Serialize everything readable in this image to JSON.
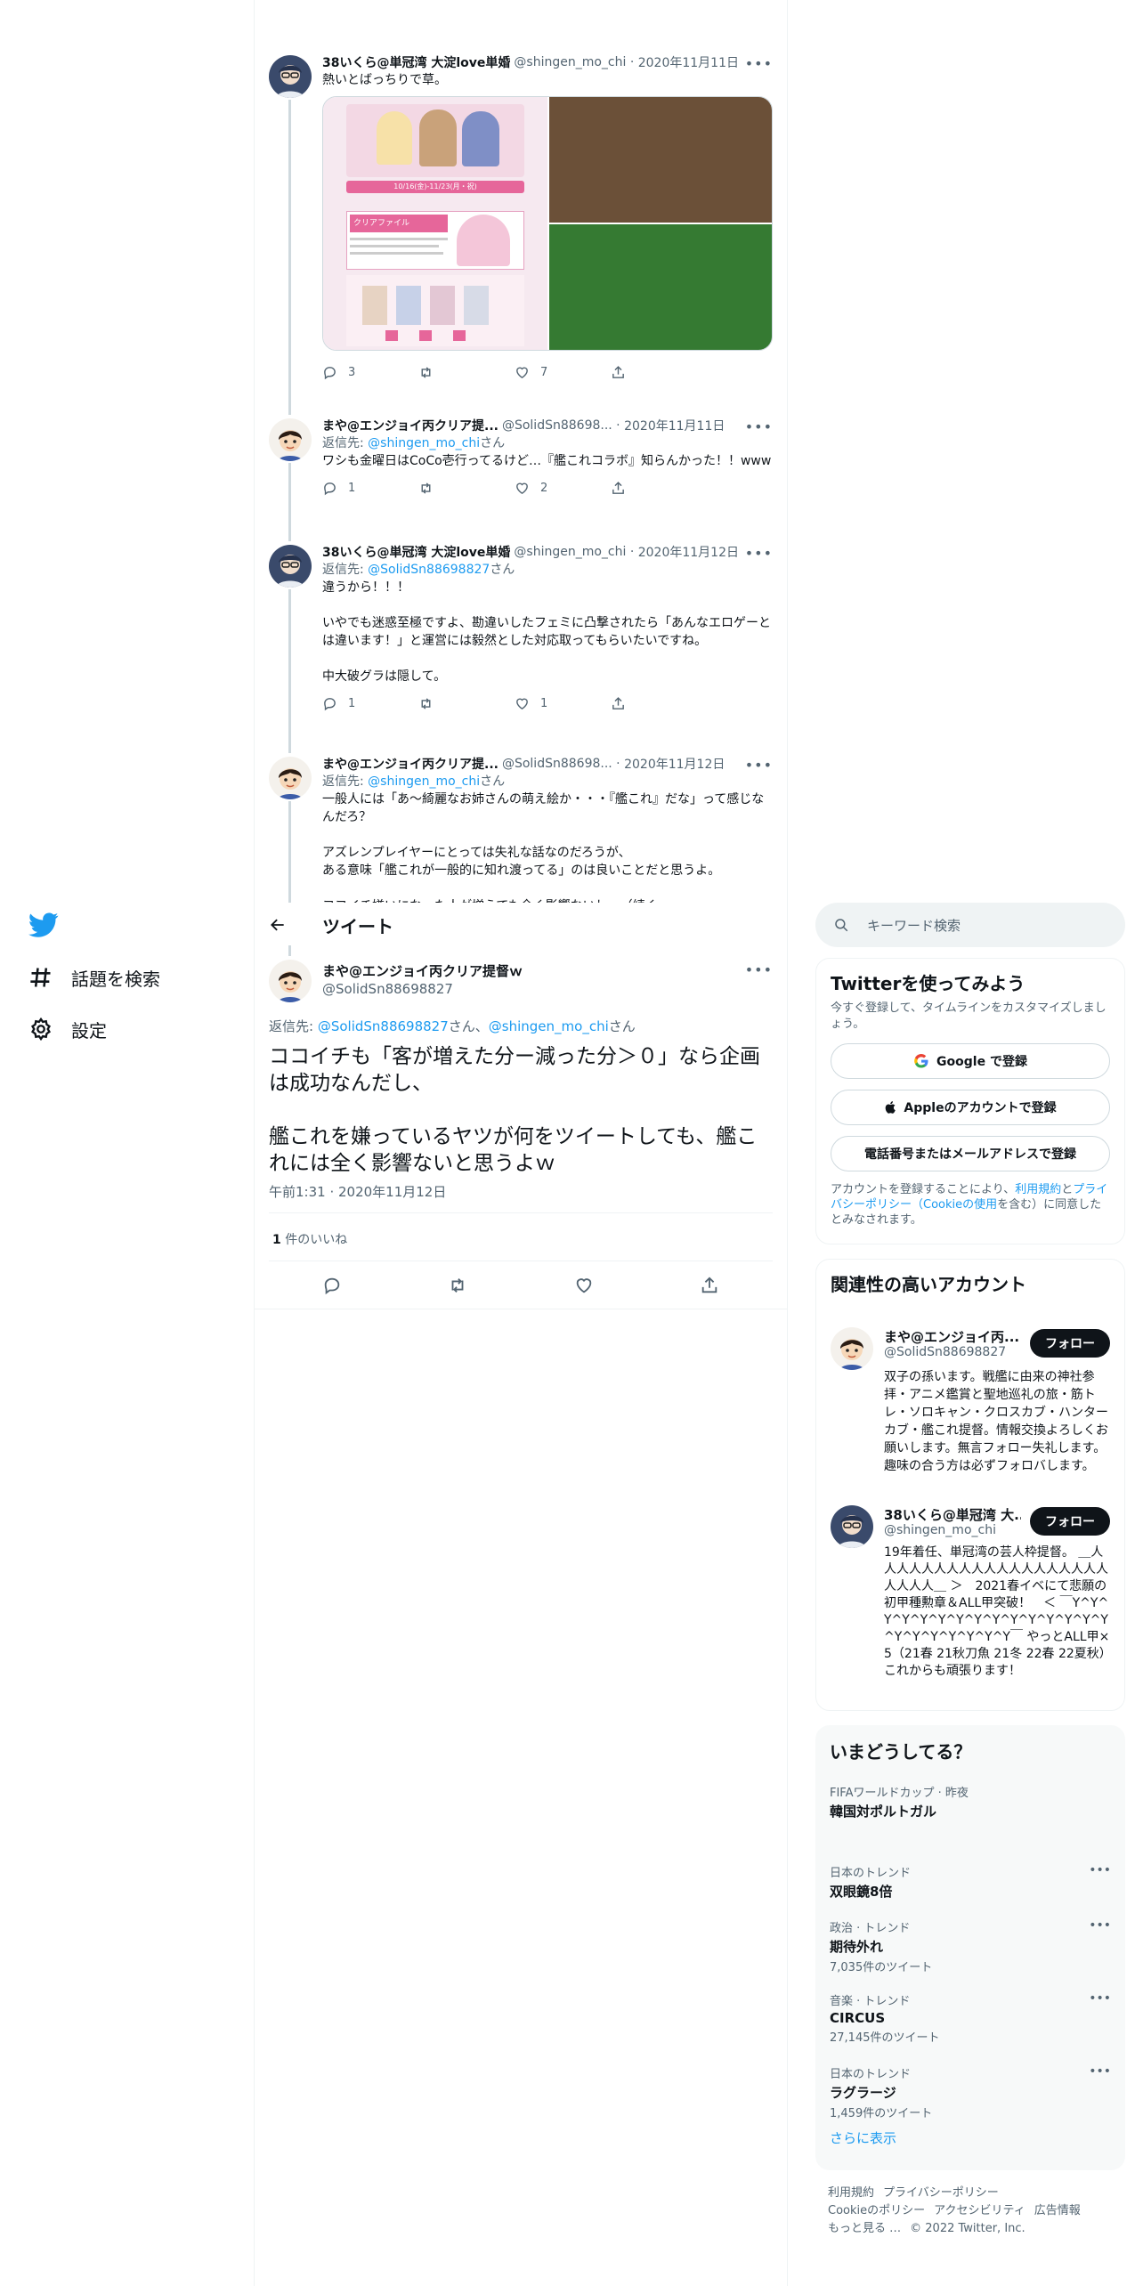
{
  "nav": {
    "items": [
      {
        "label": "話題を検索",
        "icon": "hashtag-icon"
      },
      {
        "label": "設定",
        "icon": "gear-icon"
      }
    ]
  },
  "thread": [
    {
      "name": "38いくら@単冠湾 大淀love単婚",
      "handle": "@shingen_mo_chi",
      "date": "2020年11月11日",
      "reply_to": "",
      "text": "熱いとばっちりで草。",
      "media_banner": "10/16(金)-11/23(月・祝)",
      "media_subtitle": "クリアファイル",
      "replies": "3",
      "retweets": "",
      "likes": "7"
    },
    {
      "name": "まや@エンジョイ丙クリア提...",
      "handle": "@SolidSn88698...",
      "date": "2020年11月11日",
      "reply_to": "@shingen_mo_chi",
      "text": "ワシも金曜日はCoCo壱行ってるけど…『艦これコラボ』知らんかった！！www",
      "replies": "1",
      "retweets": "",
      "likes": "2"
    },
    {
      "name": "38いくら@単冠湾 大淀love単婚",
      "handle": "@shingen_mo_chi",
      "date": "2020年11月12日",
      "reply_to": "@SolidSn88698827",
      "text": "違うから！！！\n\nいやでも迷惑至極ですよ、勘違いしたフェミに凸撃されたら「あんなエロゲーとは違います！」と運営には毅然とした対応取ってもらいたいですね。\n\n中大破グラは隠して。",
      "replies": "1",
      "retweets": "",
      "likes": "1"
    },
    {
      "name": "まや@エンジョイ丙クリア提...",
      "handle": "@SolidSn88698...",
      "date": "2020年11月12日",
      "reply_to": "@shingen_mo_chi",
      "text": "一般人には「あ～綺麗なお姉さんの萌え絵か・・・『艦これ』だな」って感じなんだろ？\n\nアズレンプレイヤーにとっては失礼な話なのだろうが、\nある意味「艦これが一般的に知れ渡ってる」のは良いことだと思うよ。\n\nココイチ嫌いになった人が増えても全く影響ないし…（続く",
      "replies": "",
      "retweets": "",
      "likes": ""
    }
  ],
  "focus": {
    "header_title": "ツイート",
    "name": "まや@エンジョイ丙クリア提督ｗ",
    "handle": "@SolidSn88698827",
    "reply_prefix": "返信先: ",
    "reply_user1": "@SolidSn88698827",
    "reply_mid": "さん、",
    "reply_user2": "@shingen_mo_chi",
    "reply_suffix": "さん",
    "text": "ココイチも「客が増えた分ー減った分＞０」なら企画は成功なんだし、\n\n艦これを嫌っているヤツが何をツイートしても、艦これには全く影響ないと思うよｗ",
    "timestamp": "午前1:31 · 2020年11月12日",
    "likes_count": "1",
    "likes_label": " 件のいいね"
  },
  "reply_prefix": "返信先: ",
  "reply_suffix": "さん",
  "search": {
    "placeholder": "キーワード検索"
  },
  "signup": {
    "title": "Twitterを使ってみよう",
    "subtitle": "今すぐ登録して、タイムラインをカスタマイズしましょう。",
    "google": "Google で登録",
    "apple": "Appleのアカウントで登録",
    "phone": "電話番号またはメールアドレスで登録",
    "legal_1": "アカウントを登録することにより、",
    "legal_terms": "利用規約",
    "legal_2": "と",
    "legal_privacy": "プライバシーポリシー（Cookieの使用",
    "legal_3": "を含む）に同意したとみなされます。"
  },
  "related": {
    "title": "関連性の高いアカウント",
    "follow": "フォロー",
    "accounts": [
      {
        "name": "まや@エンジョイ丙...",
        "handle": "@SolidSn88698827",
        "bio": "双子の孫います。戦艦に由来の神社参拝・アニメ鑑賞と聖地巡礼の旅・筋トレ・ソロキャン・クロスカブ・ハンターカブ・艦これ提督。情報交換よろしくお願いします。無言フォロー失礼します。趣味の合う方は必ずフォロバします。"
      },
      {
        "name": "38いくら@単冠湾 大...",
        "handle": "@shingen_mo_chi",
        "bio": "19年着任、単冠湾の芸人枠提督。 ＿人人人人人人人人人人人人人人人人人人人人人人人＿ ＞　2021春イベにて悲願の初甲種勲章＆ALL甲突破！　＜ ￣Y^Y^Y^Y^Y^Y^Y^Y^Y^Y^Y^Y^Y^Y^Y^Y^Y^Y^Y^Y^Y^Y￣ やっとALL甲×5（21春 21秋刀魚 21冬 22春 22夏秋） これからも頑張ります！"
      }
    ]
  },
  "trends": {
    "title": "いまどうしてる？",
    "items": [
      {
        "meta": "FIFAワールドカップ · 昨夜",
        "name": "韓国対ポルトガル",
        "count": "",
        "more": false
      },
      {
        "meta": "日本のトレンド",
        "name": "双眼鏡8倍",
        "count": "",
        "more": true
      },
      {
        "meta": "政治 · トレンド",
        "name": "期待外れ",
        "count": "7,035件のツイート",
        "more": true
      },
      {
        "meta": "音楽 · トレンド",
        "name": "CIRCUS",
        "count": "27,145件のツイート",
        "more": true
      },
      {
        "meta": "日本のトレンド",
        "name": "ラグラージ",
        "count": "1,459件のツイート",
        "more": true
      }
    ],
    "show_more": "さらに表示"
  },
  "footer": {
    "terms": "利用規約",
    "privacy": "プライバシーポリシー",
    "cookie": "Cookieのポリシー",
    "accessibility": "アクセシビリティ",
    "ads": "広告情報",
    "more": "もっと見る …",
    "copyright": "© 2022 Twitter, Inc."
  },
  "colors": {
    "accent": "#1d9bf0",
    "text": "#0f1419",
    "muted": "#536471",
    "border": "#eff3f4"
  }
}
